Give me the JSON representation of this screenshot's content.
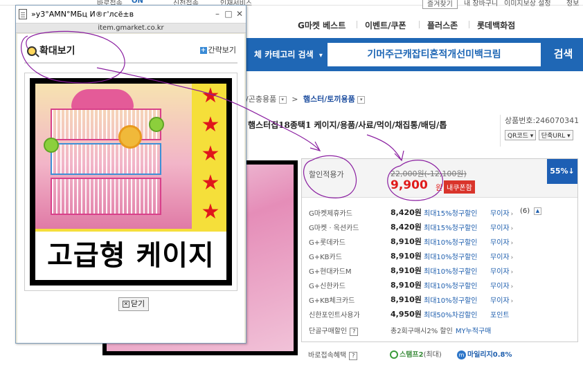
{
  "topbar": {
    "left_text": "바로접속",
    "left_badge": "ON",
    "left_link": "신전접속",
    "mid_text": "인재서비스",
    "btn_favorites": "즐겨찾기",
    "link_cart": "내 장바구니",
    "link_history": "이미지보상 설정",
    "link_more": "정보"
  },
  "nav": {
    "items": [
      "G마켓 베스트",
      "이벤트/쿠폰",
      "플러스존",
      "롯데백화점"
    ]
  },
  "search": {
    "category_label": "체 카테고리 검색",
    "query": "기머주근캐잡티혼적개선미백크림",
    "button_label": "검색"
  },
  "breadcrumb": {
    "prev": "/곤충용품",
    "current": "햄스터/토끼용품"
  },
  "product": {
    "title": "햄스터집18종택1 케이지/용품/사료/먹이/채집통/배딩/톱",
    "number_label": "상품번호:",
    "number": "246070341",
    "qr_label": "QR코드",
    "short_url_label": "단축URL"
  },
  "price": {
    "label": "할인적용가",
    "original": "22,000원(-12,100원)",
    "sale": "9,900",
    "won": "원",
    "coupon_badge": "내쿠폰함",
    "discount_badge": "55%↓"
  },
  "cards": [
    {
      "name": "G마켓제휴카드",
      "price": "8,420원",
      "rate": "최대15%청구할인",
      "interest": "무이자",
      "count": "(6)"
    },
    {
      "name": "G마켓 · 옥션카드",
      "price": "8,420원",
      "rate": "최대15%청구할인",
      "interest": "무이자"
    },
    {
      "name": "G+롯데카드",
      "price": "8,910원",
      "rate": "최대10%청구할인",
      "interest": "무이자"
    },
    {
      "name": "G+KB카드",
      "price": "8,910원",
      "rate": "최대10%청구할인",
      "interest": "무이자"
    },
    {
      "name": "G+현대카드M",
      "price": "8,910원",
      "rate": "최대10%청구할인",
      "interest": "무이자"
    },
    {
      "name": "G+신한카드",
      "price": "8,910원",
      "rate": "최대10%청구할인",
      "interest": "무이자"
    },
    {
      "name": "G+KB체크카드",
      "price": "8,910원",
      "rate": "최대10%청구할인",
      "interest": "무이자"
    },
    {
      "name": "신한포인트사용가",
      "price": "4,950원",
      "rate": "최대50%차감할인",
      "interest": "포인트"
    }
  ],
  "bulk": {
    "label": "단골구매할인",
    "desc": "총2회구매시2% 할인",
    "link": "MY누적구매"
  },
  "benefit": {
    "label": "바로접속혜택",
    "stamp": "스탬프2",
    "stamp_note": "(최대)",
    "mileage": "마일리지0.8%"
  },
  "popup": {
    "title": "»у3°АМN°МБц И®г'лсё±в",
    "url": "item.gmarket.co.kr",
    "heading": "확대보기",
    "simple_view": "간략보기",
    "caption": "고급형 케이지",
    "close_label": "닫기"
  },
  "colors": {
    "brand_blue": "#1f67b5",
    "sale_red": "#e01b1b",
    "badge_blue": "#1d5fb4"
  }
}
